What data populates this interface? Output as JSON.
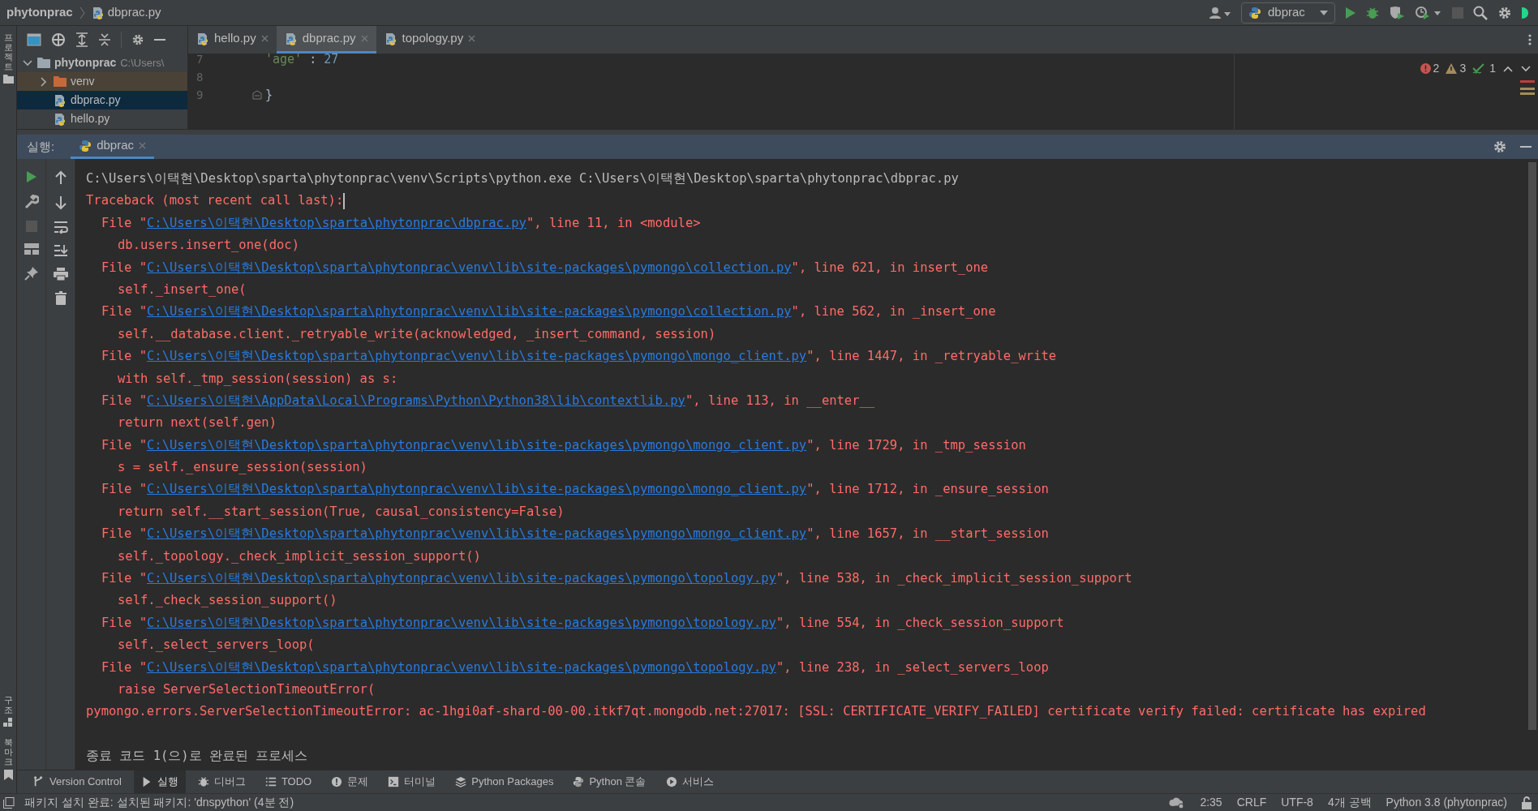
{
  "breadcrumb": [
    "phytonprac",
    "dbprac.py"
  ],
  "run_config": {
    "label": "dbprac"
  },
  "side_stripe": {
    "top": [
      "프로젝트"
    ],
    "bottom": [
      "구조",
      "북마크"
    ]
  },
  "project_tree": [
    {
      "label": "phytonprac",
      "hint": "C:\\Users\\",
      "expanded": true,
      "selected": false,
      "children": [
        {
          "label": "venv",
          "kind": "folder",
          "expanded": false,
          "selected": false
        },
        {
          "label": "dbprac.py",
          "kind": "file",
          "selected": true
        },
        {
          "label": "hello.py",
          "kind": "file",
          "selected": false
        }
      ]
    }
  ],
  "editor_tabs": [
    {
      "label": "hello.py",
      "selected": false
    },
    {
      "label": "dbprac.py",
      "selected": true
    },
    {
      "label": "topology.py",
      "selected": false
    }
  ],
  "editor_lines": [
    {
      "number": "7",
      "tokens": [
        {
          "kind": "string",
          "text": "'age'"
        },
        {
          "kind": "plain",
          "text": " : "
        },
        {
          "kind": "number",
          "text": "27"
        }
      ]
    },
    {
      "number": "8"
    },
    {
      "number": "9",
      "tokens": [
        {
          "kind": "plain",
          "text": "}"
        }
      ]
    }
  ],
  "inspections": [
    {
      "kind": "error",
      "count": "2"
    },
    {
      "kind": "warning",
      "count": "3"
    },
    {
      "kind": "typo",
      "count": "1"
    }
  ],
  "run_panel": {
    "label": "실행:",
    "tabs": [
      {
        "label": "dbprac",
        "selected": true
      }
    ]
  },
  "console": [
    {
      "kind": "plain",
      "text": "C:\\Users\\이택현\\Desktop\\sparta\\phytonprac\\venv\\Scripts\\python.exe C:\\Users\\이택현\\Desktop\\sparta\\phytonprac\\dbprac.py"
    },
    {
      "kind": "error",
      "text": "Traceback (most recent call last):",
      "cursor": true
    },
    {
      "kind": "file",
      "before": "File \"",
      "link": "C:\\Users\\이택현\\Desktop\\sparta\\phytonprac\\dbprac.py",
      "after": "\", line 11, in <module>"
    },
    {
      "kind": "code",
      "text": "db.users.insert_one(doc)"
    },
    {
      "kind": "file",
      "before": "File \"",
      "link": "C:\\Users\\이택현\\Desktop\\sparta\\phytonprac\\venv\\lib\\site-packages\\pymongo\\collection.py",
      "after": "\", line 621, in insert_one"
    },
    {
      "kind": "code",
      "text": "self._insert_one("
    },
    {
      "kind": "file",
      "before": "File \"",
      "link": "C:\\Users\\이택현\\Desktop\\sparta\\phytonprac\\venv\\lib\\site-packages\\pymongo\\collection.py",
      "after": "\", line 562, in _insert_one"
    },
    {
      "kind": "code",
      "text": "self.__database.client._retryable_write(acknowledged, _insert_command, session)"
    },
    {
      "kind": "file",
      "before": "File \"",
      "link": "C:\\Users\\이택현\\Desktop\\sparta\\phytonprac\\venv\\lib\\site-packages\\pymongo\\mongo_client.py",
      "after": "\", line 1447, in _retryable_write"
    },
    {
      "kind": "code",
      "text": "with self._tmp_session(session) as s:"
    },
    {
      "kind": "file",
      "before": "File \"",
      "link": "C:\\Users\\이택현\\AppData\\Local\\Programs\\Python\\Python38\\lib\\contextlib.py",
      "after": "\", line 113, in __enter__"
    },
    {
      "kind": "code",
      "text": "return next(self.gen)"
    },
    {
      "kind": "file",
      "before": "File \"",
      "link": "C:\\Users\\이택현\\Desktop\\sparta\\phytonprac\\venv\\lib\\site-packages\\pymongo\\mongo_client.py",
      "after": "\", line 1729, in _tmp_session"
    },
    {
      "kind": "code",
      "text": "s = self._ensure_session(session)"
    },
    {
      "kind": "file",
      "before": "File \"",
      "link": "C:\\Users\\이택현\\Desktop\\sparta\\phytonprac\\venv\\lib\\site-packages\\pymongo\\mongo_client.py",
      "after": "\", line 1712, in _ensure_session"
    },
    {
      "kind": "code",
      "text": "return self.__start_session(True, causal_consistency=False)"
    },
    {
      "kind": "file",
      "before": "File \"",
      "link": "C:\\Users\\이택현\\Desktop\\sparta\\phytonprac\\venv\\lib\\site-packages\\pymongo\\mongo_client.py",
      "after": "\", line 1657, in __start_session"
    },
    {
      "kind": "code",
      "text": "self._topology._check_implicit_session_support()"
    },
    {
      "kind": "file",
      "before": "File \"",
      "link": "C:\\Users\\이택현\\Desktop\\sparta\\phytonprac\\venv\\lib\\site-packages\\pymongo\\topology.py",
      "after": "\", line 538, in _check_implicit_session_support"
    },
    {
      "kind": "code",
      "text": "self._check_session_support()"
    },
    {
      "kind": "file",
      "before": "File \"",
      "link": "C:\\Users\\이택현\\Desktop\\sparta\\phytonprac\\venv\\lib\\site-packages\\pymongo\\topology.py",
      "after": "\", line 554, in _check_session_support"
    },
    {
      "kind": "code",
      "text": "self._select_servers_loop("
    },
    {
      "kind": "file",
      "before": "File \"",
      "link": "C:\\Users\\이택현\\Desktop\\sparta\\phytonprac\\venv\\lib\\site-packages\\pymongo\\topology.py",
      "after": "\", line 238, in _select_servers_loop"
    },
    {
      "kind": "code",
      "text": "raise ServerSelectionTimeoutError("
    },
    {
      "kind": "error",
      "text": "pymongo.errors.ServerSelectionTimeoutError: ac-1hgi0af-shard-00-00.itkf7qt.mongodb.net:27017: [SSL: CERTIFICATE_VERIFY_FAILED] certificate verify failed: certificate has expired"
    },
    {
      "kind": "blank"
    },
    {
      "kind": "plain",
      "text": "종료 코드 1(으)로 완료된 프로세스"
    }
  ],
  "tool_windows": [
    {
      "label": "Version Control",
      "selected": false
    },
    {
      "label": "실행",
      "selected": true
    },
    {
      "label": "디버그",
      "selected": false
    },
    {
      "label": "TODO",
      "selected": false
    },
    {
      "label": "문제",
      "selected": false
    },
    {
      "label": "터미널",
      "selected": false
    },
    {
      "label": "Python Packages",
      "selected": false
    },
    {
      "label": "Python 콘솔",
      "selected": false
    },
    {
      "label": "서비스",
      "selected": false
    }
  ],
  "status_bar": {
    "message": "패키지 설치 완료: 설치된 패키지: 'dnspython' (4분 전)",
    "items": [
      "2:35",
      "CRLF",
      "UTF-8",
      "4개 공백",
      "Python 3.8 (phytonprac)"
    ]
  }
}
